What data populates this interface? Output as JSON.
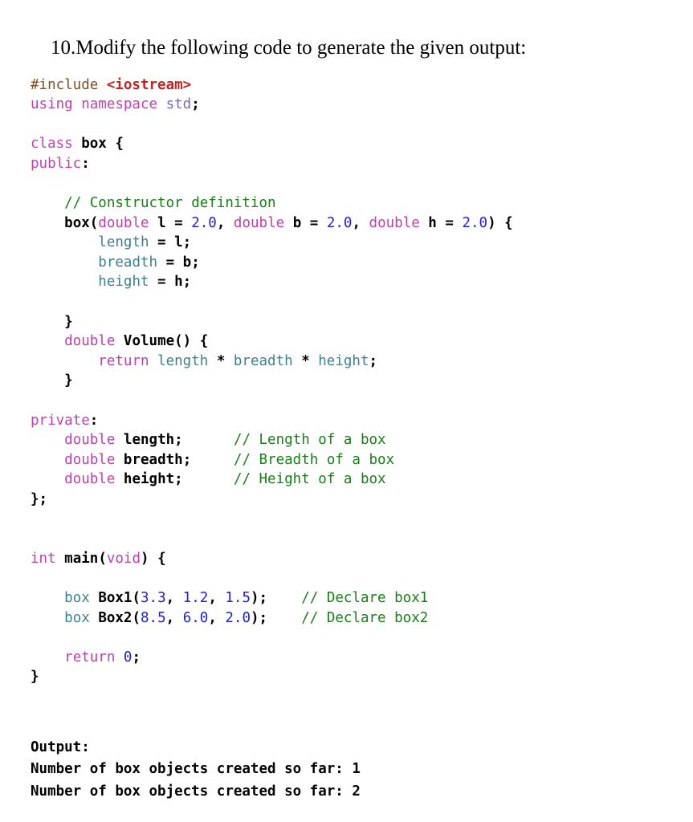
{
  "document": {
    "question_number": "10.",
    "question_text": "Modify the following code to generate the given output:"
  },
  "colors": {
    "keyword": "#bf3fb0",
    "identifier": "#3f7f93",
    "number": "#2222cc",
    "comment": "#178017",
    "preprocessor": "#7f4f2b",
    "header_string": "#c02424",
    "namespace": "#7a68bd",
    "plain": "#000000",
    "background": "#ffffff"
  },
  "code": {
    "language": "cpp",
    "lines": [
      [
        {
          "text": "#include ",
          "type": "pre"
        },
        {
          "text": "<iostream>",
          "type": "str"
        }
      ],
      [
        {
          "text": "using namespace ",
          "type": "kw"
        },
        {
          "text": "std",
          "type": "ns"
        },
        {
          "text": ";",
          "type": "punc"
        }
      ],
      [],
      [
        {
          "text": "class ",
          "type": "kw"
        },
        {
          "text": "box",
          "type": "name"
        },
        {
          "text": " {",
          "type": "punc"
        }
      ],
      [
        {
          "text": "public",
          "type": "kw"
        },
        {
          "text": ":",
          "type": "punc"
        }
      ],
      [],
      [
        {
          "text": "    ",
          "type": "plain"
        },
        {
          "text": "// Constructor definition",
          "type": "comment"
        }
      ],
      [
        {
          "text": "    ",
          "type": "plain"
        },
        {
          "text": "box",
          "type": "name"
        },
        {
          "text": "(",
          "type": "punc"
        },
        {
          "text": "double ",
          "type": "kw"
        },
        {
          "text": "l",
          "type": "name"
        },
        {
          "text": " = ",
          "type": "punc"
        },
        {
          "text": "2.0",
          "type": "num"
        },
        {
          "text": ", ",
          "type": "punc"
        },
        {
          "text": "double ",
          "type": "kw"
        },
        {
          "text": "b",
          "type": "name"
        },
        {
          "text": " = ",
          "type": "punc"
        },
        {
          "text": "2.0",
          "type": "num"
        },
        {
          "text": ", ",
          "type": "punc"
        },
        {
          "text": "double ",
          "type": "kw"
        },
        {
          "text": "h",
          "type": "name"
        },
        {
          "text": " = ",
          "type": "punc"
        },
        {
          "text": "2.0",
          "type": "num"
        },
        {
          "text": ") {",
          "type": "punc"
        }
      ],
      [
        {
          "text": "        ",
          "type": "plain"
        },
        {
          "text": "length",
          "type": "ident"
        },
        {
          "text": " = ",
          "type": "punc"
        },
        {
          "text": "l",
          "type": "name"
        },
        {
          "text": ";",
          "type": "punc"
        }
      ],
      [
        {
          "text": "        ",
          "type": "plain"
        },
        {
          "text": "breadth",
          "type": "ident"
        },
        {
          "text": " = ",
          "type": "punc"
        },
        {
          "text": "b",
          "type": "name"
        },
        {
          "text": ";",
          "type": "punc"
        }
      ],
      [
        {
          "text": "        ",
          "type": "plain"
        },
        {
          "text": "height",
          "type": "ident"
        },
        {
          "text": " = ",
          "type": "punc"
        },
        {
          "text": "h",
          "type": "name"
        },
        {
          "text": ";",
          "type": "punc"
        }
      ],
      [],
      [
        {
          "text": "    }",
          "type": "punc"
        }
      ],
      [
        {
          "text": "    ",
          "type": "plain"
        },
        {
          "text": "double ",
          "type": "kw"
        },
        {
          "text": "Volume",
          "type": "name"
        },
        {
          "text": "() {",
          "type": "punc"
        }
      ],
      [
        {
          "text": "        ",
          "type": "plain"
        },
        {
          "text": "return ",
          "type": "kw"
        },
        {
          "text": "length",
          "type": "ident"
        },
        {
          "text": " * ",
          "type": "punc"
        },
        {
          "text": "breadth",
          "type": "ident"
        },
        {
          "text": " * ",
          "type": "punc"
        },
        {
          "text": "height",
          "type": "ident"
        },
        {
          "text": ";",
          "type": "punc"
        }
      ],
      [
        {
          "text": "    }",
          "type": "punc"
        }
      ],
      [],
      [
        {
          "text": "private",
          "type": "kw"
        },
        {
          "text": ":",
          "type": "punc"
        }
      ],
      [
        {
          "text": "    ",
          "type": "plain"
        },
        {
          "text": "double ",
          "type": "kw"
        },
        {
          "text": "length",
          "type": "name"
        },
        {
          "text": ";",
          "type": "punc"
        },
        {
          "text": "      ",
          "type": "plain"
        },
        {
          "text": "// Length of a box",
          "type": "comment"
        }
      ],
      [
        {
          "text": "    ",
          "type": "plain"
        },
        {
          "text": "double ",
          "type": "kw"
        },
        {
          "text": "breadth",
          "type": "name"
        },
        {
          "text": ";",
          "type": "punc"
        },
        {
          "text": "     ",
          "type": "plain"
        },
        {
          "text": "// Breadth of a box",
          "type": "comment"
        }
      ],
      [
        {
          "text": "    ",
          "type": "plain"
        },
        {
          "text": "double ",
          "type": "kw"
        },
        {
          "text": "height",
          "type": "name"
        },
        {
          "text": ";",
          "type": "punc"
        },
        {
          "text": "      ",
          "type": "plain"
        },
        {
          "text": "// Height of a box",
          "type": "comment"
        }
      ],
      [
        {
          "text": "};",
          "type": "punc"
        }
      ],
      [],
      [],
      [
        {
          "text": "int ",
          "type": "kw"
        },
        {
          "text": "main",
          "type": "name"
        },
        {
          "text": "(",
          "type": "punc"
        },
        {
          "text": "void",
          "type": "kw"
        },
        {
          "text": ") {",
          "type": "punc"
        }
      ],
      [],
      [
        {
          "text": "    ",
          "type": "plain"
        },
        {
          "text": "box ",
          "type": "ident"
        },
        {
          "text": "Box1",
          "type": "name"
        },
        {
          "text": "(",
          "type": "punc"
        },
        {
          "text": "3.3",
          "type": "num"
        },
        {
          "text": ", ",
          "type": "punc"
        },
        {
          "text": "1.2",
          "type": "num"
        },
        {
          "text": ", ",
          "type": "punc"
        },
        {
          "text": "1.5",
          "type": "num"
        },
        {
          "text": ");",
          "type": "punc"
        },
        {
          "text": "    ",
          "type": "plain"
        },
        {
          "text": "// Declare box1",
          "type": "comment"
        }
      ],
      [
        {
          "text": "    ",
          "type": "plain"
        },
        {
          "text": "box ",
          "type": "ident"
        },
        {
          "text": "Box2",
          "type": "name"
        },
        {
          "text": "(",
          "type": "punc"
        },
        {
          "text": "8.5",
          "type": "num"
        },
        {
          "text": ", ",
          "type": "punc"
        },
        {
          "text": "6.0",
          "type": "num"
        },
        {
          "text": ", ",
          "type": "punc"
        },
        {
          "text": "2.0",
          "type": "num"
        },
        {
          "text": ");",
          "type": "punc"
        },
        {
          "text": "    ",
          "type": "plain"
        },
        {
          "text": "// Declare box2",
          "type": "comment"
        }
      ],
      [],
      [
        {
          "text": "    ",
          "type": "plain"
        },
        {
          "text": "return ",
          "type": "kw"
        },
        {
          "text": "0",
          "type": "num"
        },
        {
          "text": ";",
          "type": "punc"
        }
      ],
      [
        {
          "text": "}",
          "type": "punc"
        }
      ]
    ]
  },
  "output": {
    "label": "Output:",
    "lines": [
      "Number of box objects created so far: 1",
      "Number of box objects created so far: 2"
    ]
  }
}
